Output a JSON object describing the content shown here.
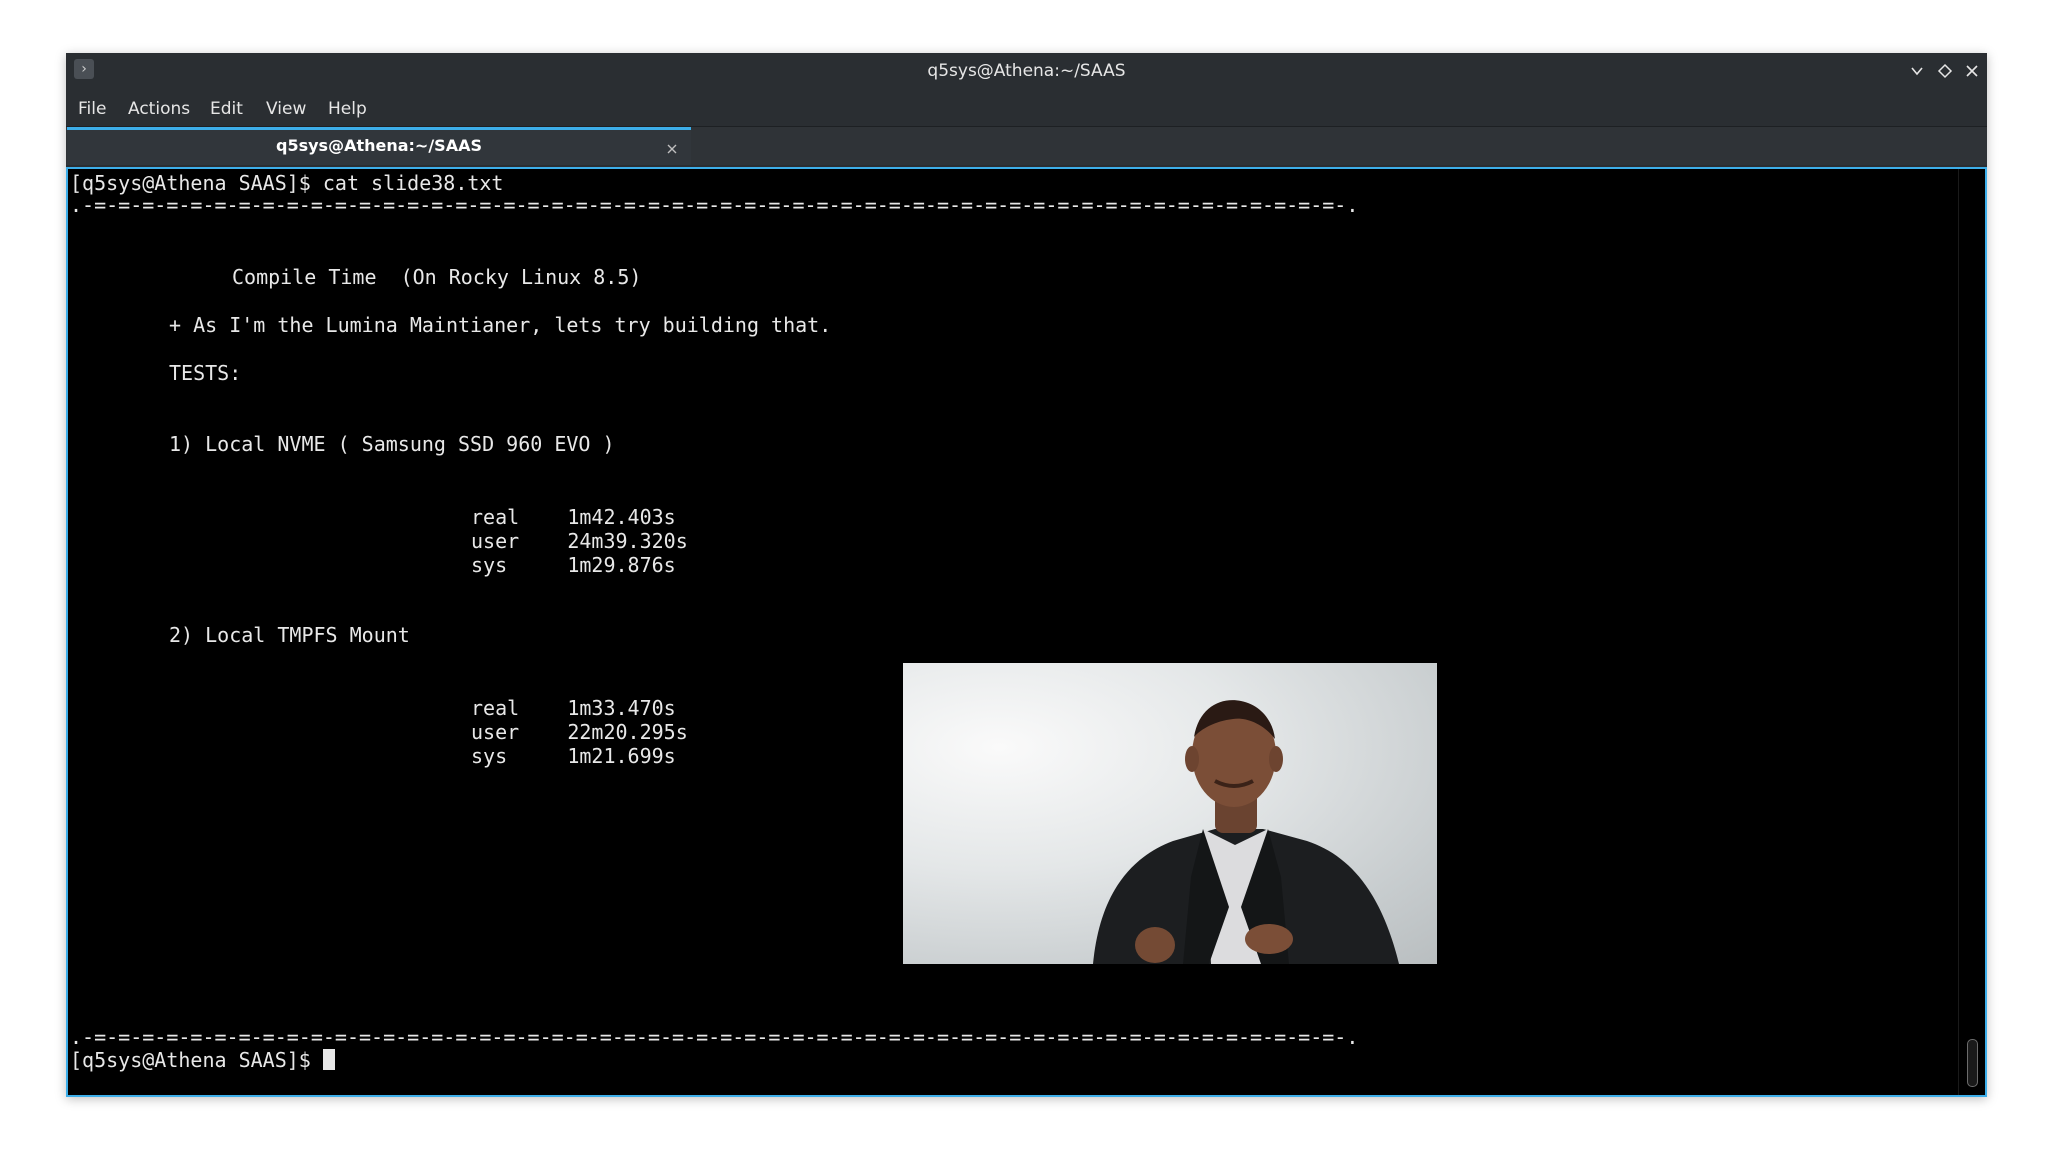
{
  "window": {
    "title": "q5sys@Athena:~/SAAS",
    "controls": [
      "minimize",
      "maximize",
      "close"
    ]
  },
  "menu": [
    "File",
    "Actions",
    "Edit",
    "View",
    "Help"
  ],
  "tabs": [
    {
      "label": "q5sys@Athena:~/SAAS",
      "active": true
    }
  ],
  "terminal": {
    "command_line": "[q5sys@Athena SAAS]$ cat slide38.txt",
    "separator": ".-=-=-=-=-=-=-=-=-=-=-=-=-=-=-=-=-=-=-=-=-=-=-=-=-=-=-=-=-=-=-=-=-=-=-=-=-=-=-=-=-=-=-=-=-=-=-=-=-=-=-=-=-.",
    "heading": "Compile Time  (On Rocky Linux 8.5)",
    "note": "+ As I'm the Lumina Maintianer, lets try building that.",
    "tests_label": "TESTS:",
    "test1": {
      "title": "1) Local NVME ( Samsung SSD 960 EVO )",
      "real": "real    1m42.403s",
      "user": "user    24m39.320s",
      "sys": "sys     1m29.876s"
    },
    "test2": {
      "title": "2) Local TMPFS Mount",
      "real": "real    1m33.470s",
      "user": "user    22m20.295s",
      "sys": "sys     1m21.699s"
    },
    "prompt": "[q5sys@Athena SAAS]$ "
  },
  "colors": {
    "accent": "#3daee9",
    "titlebar": "#2a2e32",
    "terminal_bg": "#000000",
    "terminal_fg": "#e8e8e8"
  },
  "icons": {
    "app": "terminal-icon",
    "minimize": "chevron-down-icon",
    "maximize": "diamond-icon",
    "close": "close-icon",
    "tab_close": "close-icon"
  }
}
